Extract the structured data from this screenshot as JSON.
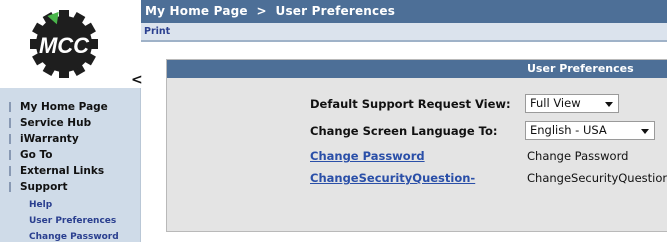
{
  "logo": {
    "text": "MCC",
    "colors": {
      "gear": "#1e1e1e",
      "arrow": "#49b54a",
      "text": "#ffffff"
    }
  },
  "sidebar": {
    "collapse_glyph": "<",
    "items": [
      {
        "label": "My Home Page"
      },
      {
        "label": "Service Hub"
      },
      {
        "label": "iWarranty"
      },
      {
        "label": "Go To"
      },
      {
        "label": "External Links"
      },
      {
        "label": "Support"
      }
    ],
    "sub_items": [
      {
        "label": "Help"
      },
      {
        "label": "User Preferences"
      },
      {
        "label": "Change Password"
      }
    ]
  },
  "header": {
    "breadcrumb": "My Home Page  >  User Preferences"
  },
  "toolbar": {
    "print_label": "Print"
  },
  "panel": {
    "title": "User Preferences",
    "default_view": {
      "label": "Default Support Request View:",
      "value": "Full View"
    },
    "language": {
      "label": "Change Screen Language To:",
      "value": "English - USA"
    },
    "change_password": {
      "link": "Change Password",
      "value": "Change Password"
    },
    "security_question": {
      "link": "ChangeSecurityQuestion-",
      "value": "ChangeSecurityQuestion-"
    }
  },
  "colors": {
    "header_blue": "#4d6f97",
    "sidebar_bg": "#cfdbe8",
    "link_blue": "#2a4fa8",
    "panel_bg": "#e4e4e4"
  }
}
